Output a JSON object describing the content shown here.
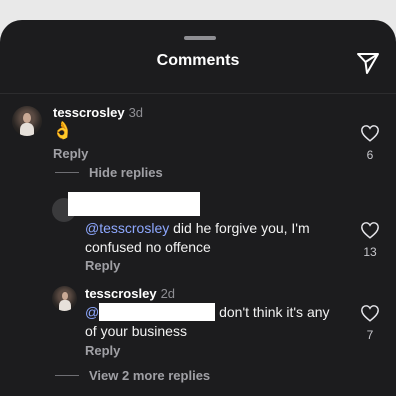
{
  "sheet": {
    "title": "Comments"
  },
  "comments": [
    {
      "username": "tesscrosley",
      "time": "3d",
      "text": "👌",
      "reply_label": "Reply",
      "likes": "6"
    },
    {
      "username": "",
      "time": "",
      "text": "did he forgive you, I'm confused no offence",
      "mention": "@tesscrosley",
      "reply_label": "Reply",
      "likes": "13"
    },
    {
      "username": "tesscrosley",
      "time": "2d",
      "mention": "@",
      "text_line1": " don't think it's any",
      "text_line2": "of your business",
      "reply_label": "Reply",
      "likes": "7"
    }
  ],
  "hide_replies_label": "Hide replies",
  "view_more_label": "View 2 more replies",
  "colors": {
    "background": "#1c1c1e",
    "mention": "#8ea8ff",
    "secondary": "#a0a0a5"
  },
  "icons": [
    "send-icon",
    "heart-icon"
  ]
}
